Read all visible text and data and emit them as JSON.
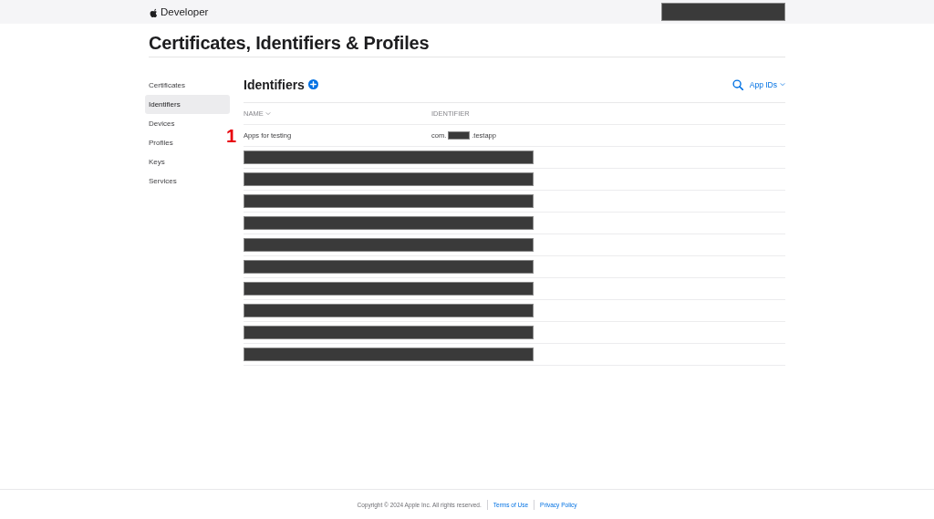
{
  "header": {
    "brand": "Developer",
    "account": {
      "kind": "redacted"
    }
  },
  "page_title": "Certificates, Identifiers & Profiles",
  "sidebar": {
    "items": [
      {
        "label": "Certificates",
        "selected": false
      },
      {
        "label": "Identifiers",
        "selected": true
      },
      {
        "label": "Devices",
        "selected": false
      },
      {
        "label": "Profiles",
        "selected": false
      },
      {
        "label": "Keys",
        "selected": false
      },
      {
        "label": "Services",
        "selected": false
      }
    ]
  },
  "section": {
    "title": "Identifiers",
    "filter": "App IDs"
  },
  "table": {
    "columns": [
      "NAME",
      "IDENTIFIER"
    ],
    "annotation": "1",
    "rows": [
      {
        "kind": "entry",
        "name": "Apps for testing",
        "identifier_prefix": "com.",
        "identifier_suffix": ".testapp"
      },
      {
        "kind": "redacted"
      },
      {
        "kind": "redacted"
      },
      {
        "kind": "redacted"
      },
      {
        "kind": "redacted"
      },
      {
        "kind": "redacted"
      },
      {
        "kind": "redacted"
      },
      {
        "kind": "redacted"
      },
      {
        "kind": "redacted"
      },
      {
        "kind": "redacted"
      },
      {
        "kind": "redacted"
      }
    ]
  },
  "footer": {
    "copyright": "Copyright © 2024 Apple Inc. All rights reserved.",
    "links": [
      "Terms of Use",
      "Privacy Policy"
    ]
  }
}
